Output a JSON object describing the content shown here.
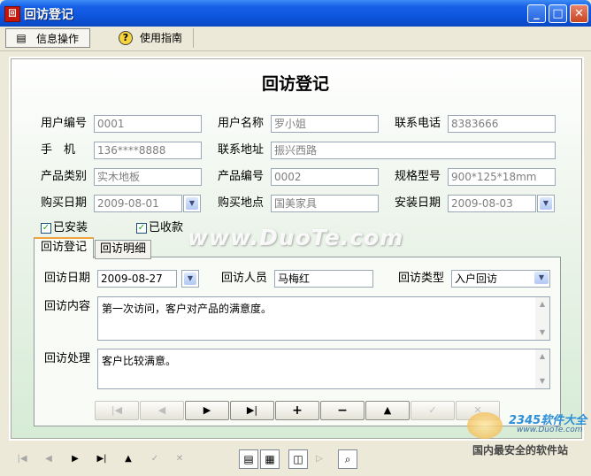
{
  "window": {
    "title": "回访登记",
    "app_icon_text": "回"
  },
  "menu": {
    "info_ops": "信息操作",
    "guide": "使用指南"
  },
  "form": {
    "title": "回访登记",
    "labels": {
      "user_no": "用户编号",
      "user_name": "用户名称",
      "phone": "联系电话",
      "mobile": "手　机",
      "address": "联系地址",
      "product_cat": "产品类别",
      "product_no": "产品编号",
      "spec": "规格型号",
      "buy_date": "购买日期",
      "buy_place": "购买地点",
      "install_date": "安装日期"
    },
    "values": {
      "user_no": "0001",
      "user_name": "罗小姐",
      "phone": "8383666",
      "mobile": "136****8888",
      "address": "振兴西路",
      "product_cat": "实木地板",
      "product_no": "0002",
      "spec": "900*125*18mm",
      "buy_date": "2009-08-01",
      "buy_place": "国美家具",
      "install_date": "2009-08-03"
    },
    "checks": {
      "installed": "已安装",
      "paid": "已收款"
    }
  },
  "tabs": {
    "register": "回访登记",
    "detail": "回访明细"
  },
  "visit": {
    "labels": {
      "date": "回访日期",
      "person": "回访人员",
      "type": "回访类型",
      "content": "回访内容",
      "handling": "回访处理"
    },
    "values": {
      "date": "2009-08-27",
      "person": "马梅红",
      "type": "入户回访",
      "content": "第一次访问，客户对产品的满意度。",
      "handling": "客户比较满意。"
    }
  },
  "watermark": "www.DuoTe.com",
  "logo": {
    "brand": "2345软件大全",
    "url": "www.DuoTe.com",
    "slogan": "国内最安全的软件站"
  },
  "colors": {
    "titlebar": "#0b52d8",
    "frame_gradient_end": "#d6ebd6",
    "tab_accent": "#f1a43c"
  }
}
